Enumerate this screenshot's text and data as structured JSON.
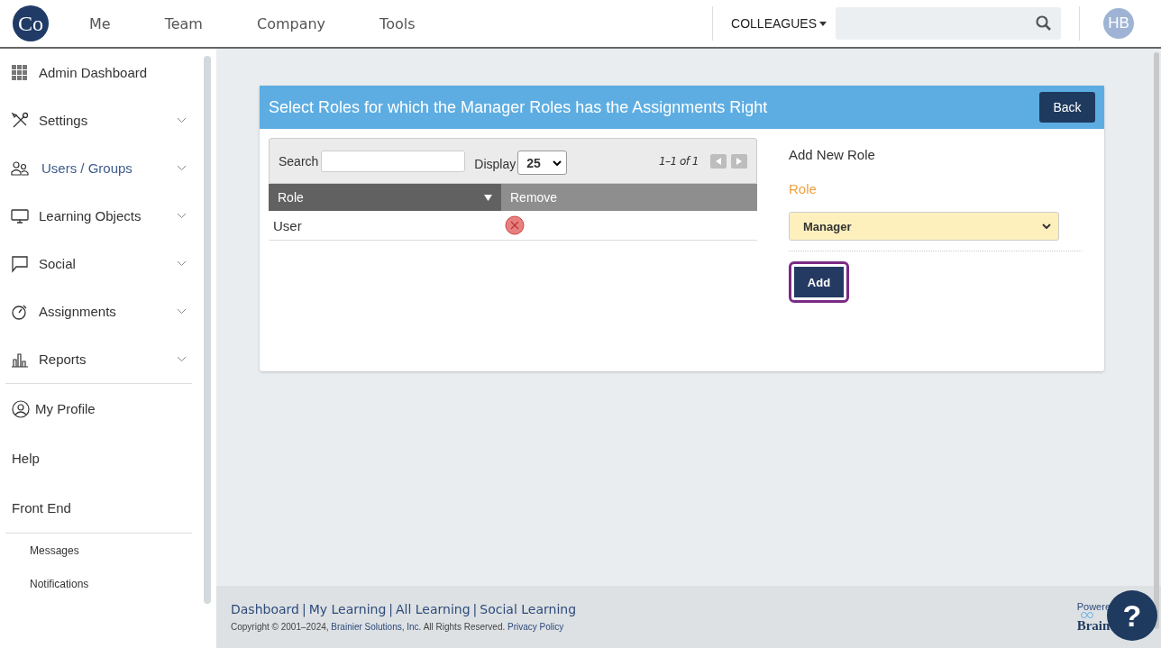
{
  "header": {
    "logo_text": "Co",
    "nav": [
      {
        "label": "Me"
      },
      {
        "label": "Team"
      },
      {
        "label": "Company"
      },
      {
        "label": "Tools"
      }
    ],
    "colleagues": "COLLEAGUES",
    "avatar": "HB"
  },
  "sidebar": {
    "items": [
      {
        "label": "Admin Dashboard",
        "selected": false,
        "expandable": false
      },
      {
        "label": "Settings",
        "selected": false,
        "expandable": true
      },
      {
        "label": "Users / Groups",
        "selected": true,
        "expandable": true
      },
      {
        "label": "Learning Objects",
        "selected": false,
        "expandable": true
      },
      {
        "label": "Social",
        "selected": false,
        "expandable": true
      },
      {
        "label": "Assignments",
        "selected": false,
        "expandable": true
      },
      {
        "label": "Reports",
        "selected": false,
        "expandable": true
      }
    ],
    "links": [
      {
        "label": "My Profile",
        "kind": "icon"
      },
      {
        "label": "Help",
        "kind": "plain"
      },
      {
        "label": "Front End",
        "kind": "plain"
      }
    ],
    "sub_links": [
      {
        "label": "Messages"
      },
      {
        "label": "Notifications"
      }
    ]
  },
  "card": {
    "title": "Select Roles for which the Manager Roles has the Assignments Right",
    "back": "Back",
    "table": {
      "search_label": "Search",
      "display_label": "Display",
      "display_value": "25",
      "pager": "1–1 of 1",
      "columns": [
        "Role",
        "Remove"
      ],
      "rows": [
        {
          "role": "User"
        }
      ]
    },
    "form": {
      "heading": "Add New Role",
      "label": "Role",
      "value": "Manager",
      "add": "Add"
    }
  },
  "footer": {
    "links": [
      "Dashboard",
      "My Learning",
      "All Learning",
      "Social Learning"
    ],
    "separator": "|",
    "copyright_prefix": "Copyright © 2001–2024,",
    "company": "Brainier Solutions, Inc.",
    "rights": "All Rights Reserved.",
    "privacy": "Privacy Policy",
    "powered": "Powere",
    "brand": "Brain",
    "help": "?"
  }
}
